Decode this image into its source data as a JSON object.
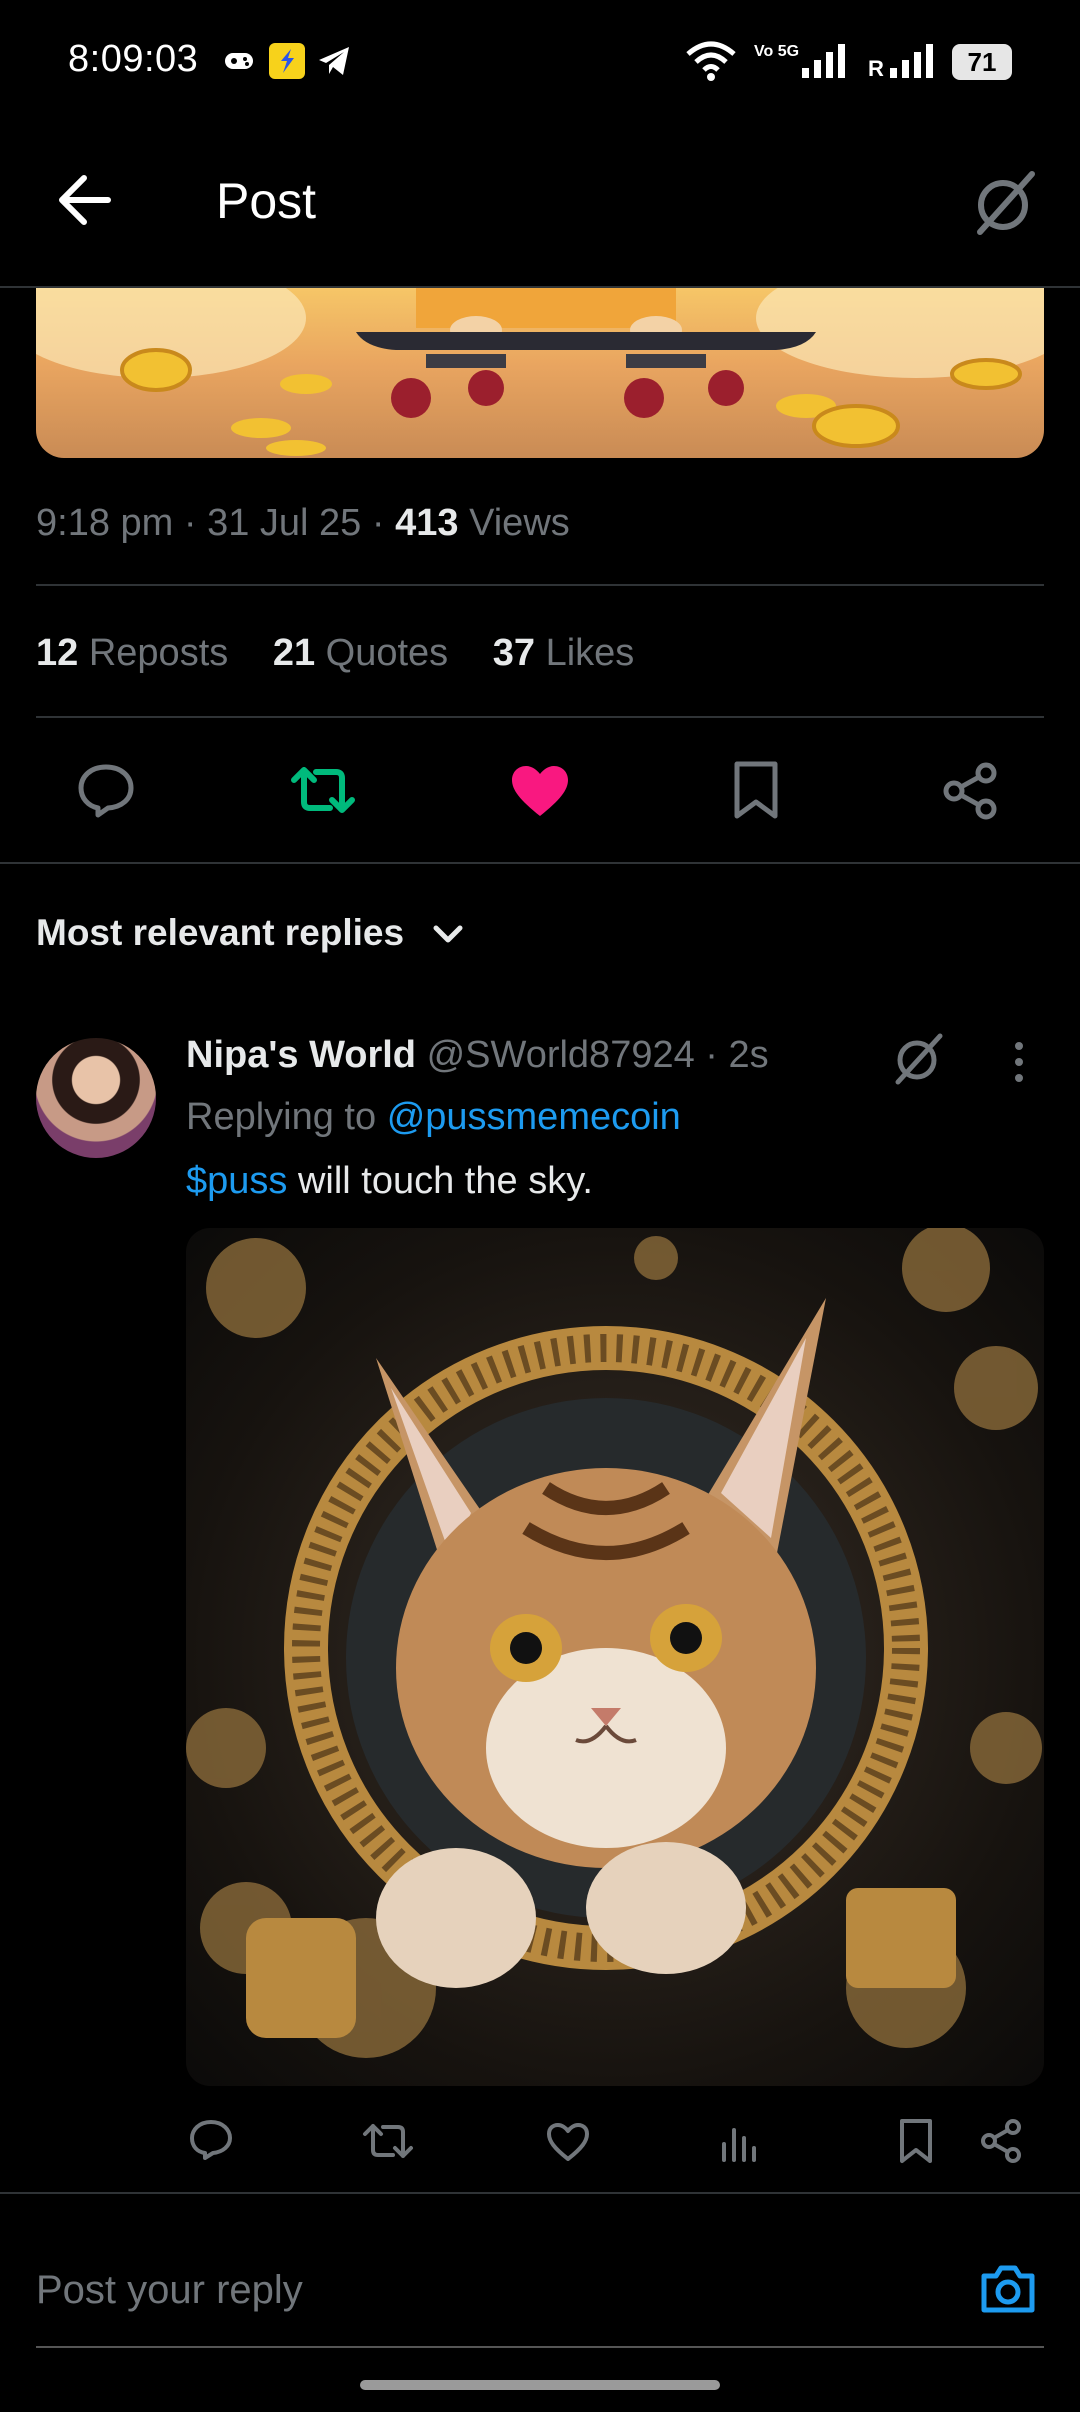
{
  "status_bar": {
    "time": "8:09:03",
    "network_label": "Vo 5G",
    "roaming_label": "R",
    "battery": "71"
  },
  "header": {
    "title": "Post"
  },
  "post": {
    "time": "9:18 pm",
    "date": "31 Jul 25",
    "views_count": "413",
    "views_label": "Views",
    "reposts_count": "12",
    "reposts_label": "Reposts",
    "quotes_count": "21",
    "quotes_label": "Quotes",
    "likes_count": "37",
    "likes_label": "Likes"
  },
  "replies": {
    "sort_label": "Most relevant replies",
    "items": [
      {
        "display_name": "Nipa's World",
        "handle": "@SWorld87924",
        "age": "2s",
        "replying_prefix": "Replying to",
        "replying_to": "@pussmemecoin",
        "cashtag": "$puss",
        "text_rest": " will touch the sky."
      }
    ]
  },
  "composer": {
    "placeholder": "Post your reply"
  },
  "colors": {
    "background": "#000000",
    "text": "#e7e9ea",
    "muted": "#71767b",
    "accent_blue": "#1d9bf0",
    "repost_green": "#00ba7c",
    "like_pink": "#f91880",
    "divider": "#2f3336"
  }
}
